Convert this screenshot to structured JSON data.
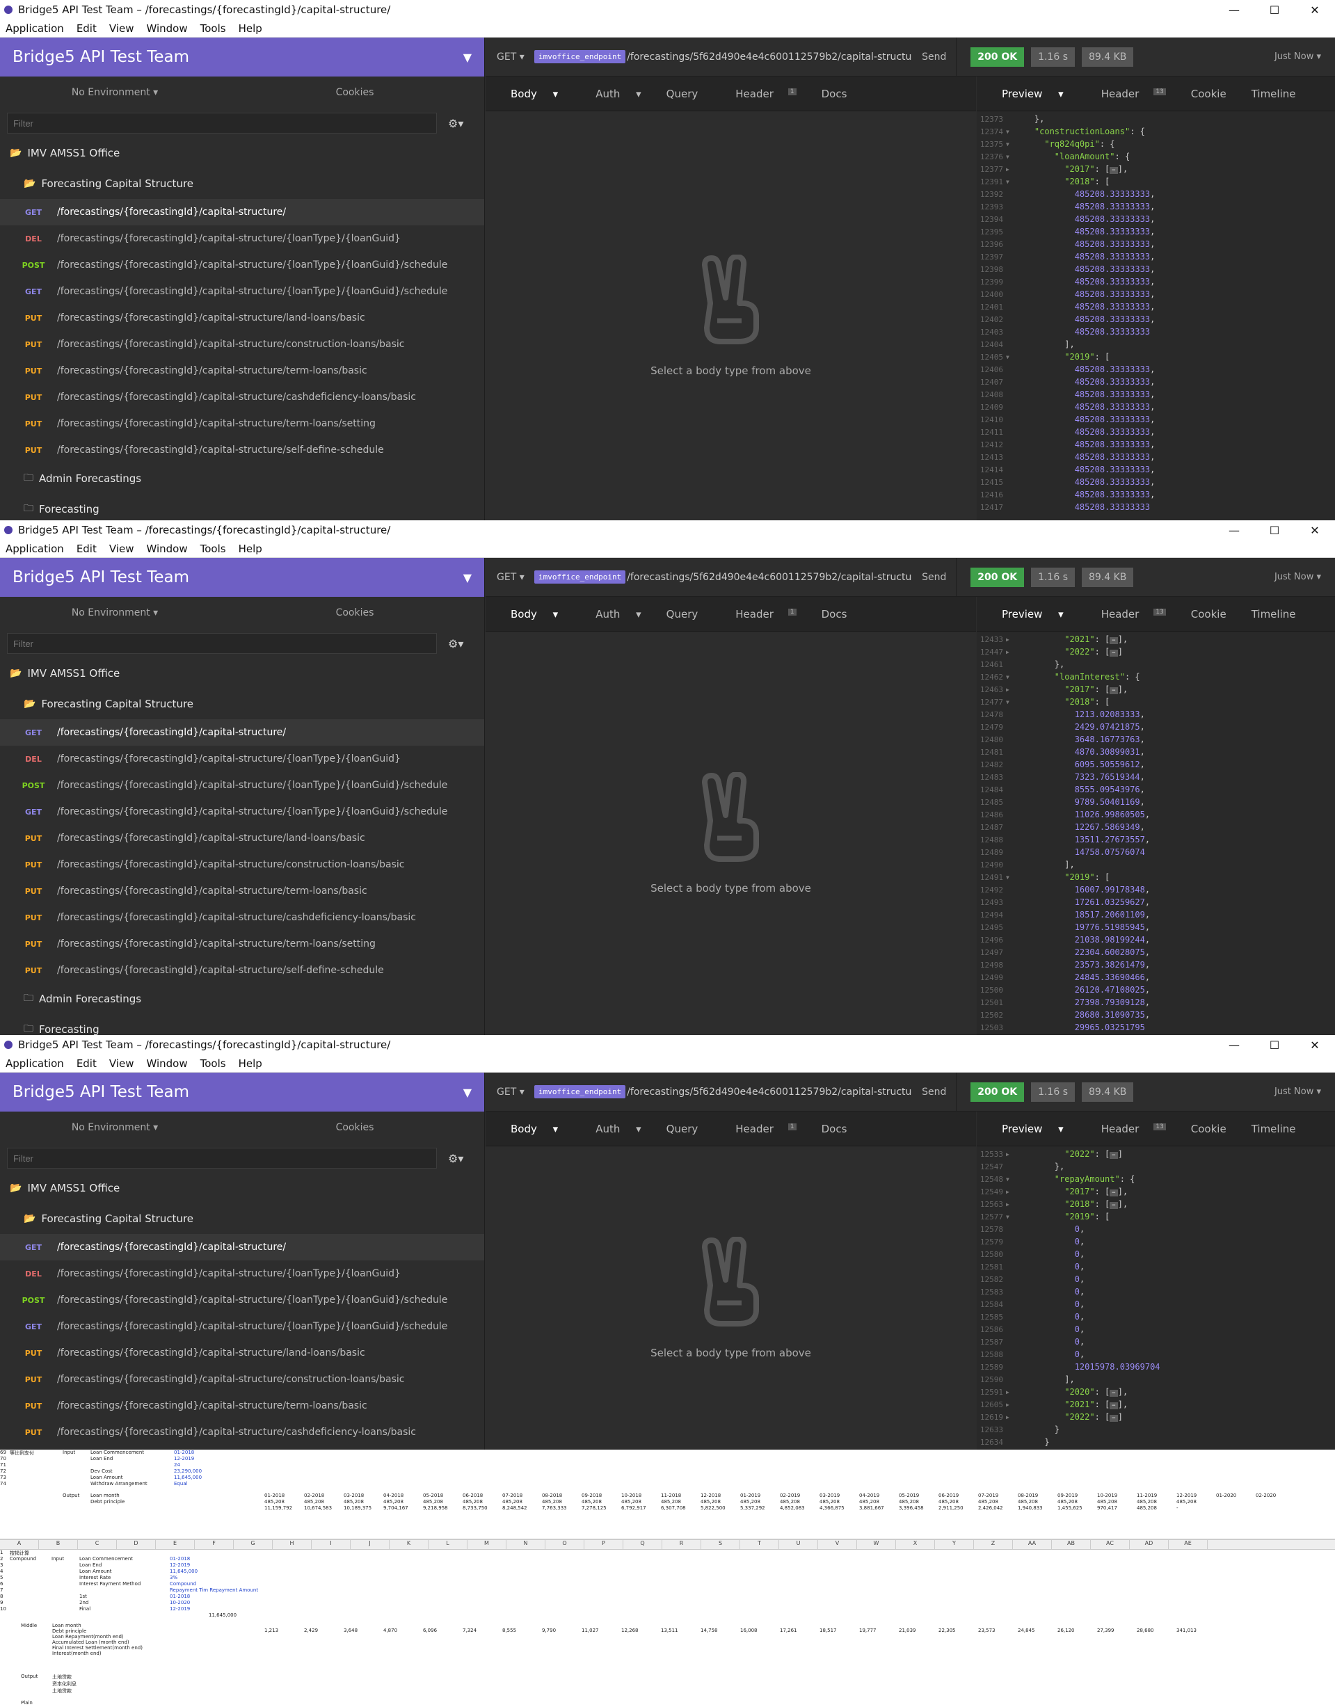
{
  "app": {
    "title": "Bridge5 API Test Team – /forecastings/{forecastingId}/capital-structure/",
    "window_controls": [
      "—",
      "☐",
      "✕"
    ],
    "menu": [
      "Application",
      "Edit",
      "View",
      "Window",
      "Tools",
      "Help"
    ]
  },
  "sidebar": {
    "team": "Bridge5 API Test Team",
    "environment": "No Environment",
    "cookies": "Cookies",
    "filter_placeholder": "Filter",
    "workspace": "IMV AMSS1 Office",
    "folder": "Forecasting Capital Structure",
    "requests": [
      {
        "method": "GET",
        "path": "/forecastings/{forecastingId}/capital-structure/"
      },
      {
        "method": "DEL",
        "path": "/forecastings/{forecastingId}/capital-structure/{loanType}/{loanGuid}"
      },
      {
        "method": "POST",
        "path": "/forecastings/{forecastingId}/capital-structure/{loanType}/{loanGuid}/schedule"
      },
      {
        "method": "GET",
        "path": "/forecastings/{forecastingId}/capital-structure/{loanType}/{loanGuid}/schedule"
      },
      {
        "method": "PUT",
        "path": "/forecastings/{forecastingId}/capital-structure/land-loans/basic"
      },
      {
        "method": "PUT",
        "path": "/forecastings/{forecastingId}/capital-structure/construction-loans/basic"
      },
      {
        "method": "PUT",
        "path": "/forecastings/{forecastingId}/capital-structure/term-loans/basic"
      },
      {
        "method": "PUT",
        "path": "/forecastings/{forecastingId}/capital-structure/cashdeficiency-loans/basic"
      },
      {
        "method": "PUT",
        "path": "/forecastings/{forecastingId}/capital-structure/term-loans/setting"
      },
      {
        "method": "PUT",
        "path": "/forecastings/{forecastingId}/capital-structure/self-define-schedule"
      }
    ],
    "other_folders": [
      "Admin Forecastings",
      "Forecasting"
    ]
  },
  "urlbar": {
    "method": "GET",
    "variable": "imvoffice_endpoint",
    "path": "/forecastings/5f62d490e4e4c600112579b2/capital-structure",
    "send": "Send",
    "status": "200 OK",
    "time": "1.16 s",
    "size": "89.4 KB",
    "when": "Just Now"
  },
  "request_tabs": [
    "Body",
    "Auth",
    "Query",
    "Header",
    "Docs"
  ],
  "request_header_count": "1",
  "response_tabs": [
    "Preview",
    "Header",
    "Cookie",
    "Timeline"
  ],
  "response_header_count": "13",
  "empty_body_hint": "Select a body type from above",
  "response1": [
    {
      "no": "12373",
      "arrow": "",
      "code": "    },"
    },
    {
      "no": "12374",
      "arrow": "▼",
      "code": "    \"constructionLoans\": {"
    },
    {
      "no": "12375",
      "arrow": "▼",
      "code": "      \"rq824q0pi\": {"
    },
    {
      "no": "12376",
      "arrow": "▼",
      "code": "        \"loanAmount\": {"
    },
    {
      "no": "12377",
      "arrow": "▶",
      "code": "          \"2017\": [⋯],"
    },
    {
      "no": "12391",
      "arrow": "▼",
      "code": "          \"2018\": ["
    },
    {
      "no": "12392",
      "arrow": "",
      "code": "            485208.33333333,"
    },
    {
      "no": "12393",
      "arrow": "",
      "code": "            485208.33333333,"
    },
    {
      "no": "12394",
      "arrow": "",
      "code": "            485208.33333333,"
    },
    {
      "no": "12395",
      "arrow": "",
      "code": "            485208.33333333,"
    },
    {
      "no": "12396",
      "arrow": "",
      "code": "            485208.33333333,"
    },
    {
      "no": "12397",
      "arrow": "",
      "code": "            485208.33333333,"
    },
    {
      "no": "12398",
      "arrow": "",
      "code": "            485208.33333333,"
    },
    {
      "no": "12399",
      "arrow": "",
      "code": "            485208.33333333,"
    },
    {
      "no": "12400",
      "arrow": "",
      "code": "            485208.33333333,"
    },
    {
      "no": "12401",
      "arrow": "",
      "code": "            485208.33333333,"
    },
    {
      "no": "12402",
      "arrow": "",
      "code": "            485208.33333333,"
    },
    {
      "no": "12403",
      "arrow": "",
      "code": "            485208.33333333"
    },
    {
      "no": "12404",
      "arrow": "",
      "code": "          ],"
    },
    {
      "no": "12405",
      "arrow": "▼",
      "code": "          \"2019\": ["
    },
    {
      "no": "12406",
      "arrow": "",
      "code": "            485208.33333333,"
    },
    {
      "no": "12407",
      "arrow": "",
      "code": "            485208.33333333,"
    },
    {
      "no": "12408",
      "arrow": "",
      "code": "            485208.33333333,"
    },
    {
      "no": "12409",
      "arrow": "",
      "code": "            485208.33333333,"
    },
    {
      "no": "12410",
      "arrow": "",
      "code": "            485208.33333333,"
    },
    {
      "no": "12411",
      "arrow": "",
      "code": "            485208.33333333,"
    },
    {
      "no": "12412",
      "arrow": "",
      "code": "            485208.33333333,"
    },
    {
      "no": "12413",
      "arrow": "",
      "code": "            485208.33333333,"
    },
    {
      "no": "12414",
      "arrow": "",
      "code": "            485208.33333333,"
    },
    {
      "no": "12415",
      "arrow": "",
      "code": "            485208.33333333,"
    },
    {
      "no": "12416",
      "arrow": "",
      "code": "            485208.33333333,"
    },
    {
      "no": "12417",
      "arrow": "",
      "code": "            485208.33333333"
    }
  ],
  "response2": [
    {
      "no": "12433",
      "arrow": "▶",
      "code": "          \"2021\": [⋯],"
    },
    {
      "no": "12447",
      "arrow": "▶",
      "code": "          \"2022\": [⋯]"
    },
    {
      "no": "12461",
      "arrow": "",
      "code": "        },"
    },
    {
      "no": "12462",
      "arrow": "▼",
      "code": "        \"loanInterest\": {"
    },
    {
      "no": "12463",
      "arrow": "▶",
      "code": "          \"2017\": [⋯],"
    },
    {
      "no": "12477",
      "arrow": "▼",
      "code": "          \"2018\": ["
    },
    {
      "no": "12478",
      "arrow": "",
      "code": "            1213.02083333,"
    },
    {
      "no": "12479",
      "arrow": "",
      "code": "            2429.07421875,"
    },
    {
      "no": "12480",
      "arrow": "",
      "code": "            3648.16773763,"
    },
    {
      "no": "12481",
      "arrow": "",
      "code": "            4870.30899031,"
    },
    {
      "no": "12482",
      "arrow": "",
      "code": "            6095.50559612,"
    },
    {
      "no": "12483",
      "arrow": "",
      "code": "            7323.76519344,"
    },
    {
      "no": "12484",
      "arrow": "",
      "code": "            8555.09543976,"
    },
    {
      "no": "12485",
      "arrow": "",
      "code": "            9789.50401169,"
    },
    {
      "no": "12486",
      "arrow": "",
      "code": "            11026.99860505,"
    },
    {
      "no": "12487",
      "arrow": "",
      "code": "            12267.5869349,"
    },
    {
      "no": "12488",
      "arrow": "",
      "code": "            13511.27673557,"
    },
    {
      "no": "12489",
      "arrow": "",
      "code": "            14758.07576074"
    },
    {
      "no": "12490",
      "arrow": "",
      "code": "          ],"
    },
    {
      "no": "12491",
      "arrow": "▼",
      "code": "          \"2019\": ["
    },
    {
      "no": "12492",
      "arrow": "",
      "code": "            16007.99178348,"
    },
    {
      "no": "12493",
      "arrow": "",
      "code": "            17261.03259627,"
    },
    {
      "no": "12494",
      "arrow": "",
      "code": "            18517.20601109,"
    },
    {
      "no": "12495",
      "arrow": "",
      "code": "            19776.51985945,"
    },
    {
      "no": "12496",
      "arrow": "",
      "code": "            21038.98199244,"
    },
    {
      "no": "12497",
      "arrow": "",
      "code": "            22304.60028075,"
    },
    {
      "no": "12498",
      "arrow": "",
      "code": "            23573.38261479,"
    },
    {
      "no": "12499",
      "arrow": "",
      "code": "            24845.33690466,"
    },
    {
      "no": "12500",
      "arrow": "",
      "code": "            26120.47108025,"
    },
    {
      "no": "12501",
      "arrow": "",
      "code": "            27398.79309128,"
    },
    {
      "no": "12502",
      "arrow": "",
      "code": "            28680.31090735,"
    },
    {
      "no": "12503",
      "arrow": "",
      "code": "            29965.03251795"
    }
  ],
  "response3": [
    {
      "no": "12533",
      "arrow": "▶",
      "code": "          \"2022\": [⋯]"
    },
    {
      "no": "12547",
      "arrow": "",
      "code": "        },"
    },
    {
      "no": "12548",
      "arrow": "▼",
      "code": "        \"repayAmount\": {"
    },
    {
      "no": "12549",
      "arrow": "▶",
      "code": "          \"2017\": [⋯],"
    },
    {
      "no": "12563",
      "arrow": "▶",
      "code": "          \"2018\": [⋯],"
    },
    {
      "no": "12577",
      "arrow": "▼",
      "code": "          \"2019\": ["
    },
    {
      "no": "12578",
      "arrow": "",
      "code": "            0,"
    },
    {
      "no": "12579",
      "arrow": "",
      "code": "            0,"
    },
    {
      "no": "12580",
      "arrow": "",
      "code": "            0,"
    },
    {
      "no": "12581",
      "arrow": "",
      "code": "            0,"
    },
    {
      "no": "12582",
      "arrow": "",
      "code": "            0,"
    },
    {
      "no": "12583",
      "arrow": "",
      "code": "            0,"
    },
    {
      "no": "12584",
      "arrow": "",
      "code": "            0,"
    },
    {
      "no": "12585",
      "arrow": "",
      "code": "            0,"
    },
    {
      "no": "12586",
      "arrow": "",
      "code": "            0,"
    },
    {
      "no": "12587",
      "arrow": "",
      "code": "            0,"
    },
    {
      "no": "12588",
      "arrow": "",
      "code": "            0,"
    },
    {
      "no": "12589",
      "arrow": "",
      "code": "            12015978.03969704"
    },
    {
      "no": "12590",
      "arrow": "",
      "code": "          ],"
    },
    {
      "no": "12591",
      "arrow": "▶",
      "code": "          \"2020\": [⋯],"
    },
    {
      "no": "12605",
      "arrow": "▶",
      "code": "          \"2021\": [⋯],"
    },
    {
      "no": "12619",
      "arrow": "▶",
      "code": "          \"2022\": [⋯]"
    },
    {
      "no": "12633",
      "arrow": "",
      "code": "        }"
    },
    {
      "no": "12634",
      "arrow": "",
      "code": "      }"
    }
  ],
  "sheet_top": {
    "rows": [
      {
        "rn": "69",
        "a": "等比例支付",
        "b": "Input",
        "c": "Loan Commencement",
        "d": "01-2018"
      },
      {
        "rn": "70",
        "a": "",
        "b": "",
        "c": "Loan End",
        "d": "12-2019"
      },
      {
        "rn": "71",
        "a": "",
        "b": "",
        "c": "",
        "d": "24"
      },
      {
        "rn": "72",
        "a": "",
        "b": "",
        "c": "Dev Cost",
        "d": "23,290,000"
      },
      {
        "rn": "73",
        "a": "",
        "b": "",
        "c": "Loan Amount",
        "d": "11,645,000"
      },
      {
        "rn": "74",
        "a": "",
        "b": "",
        "c": "Withdraw Arrangement",
        "d": "Equal"
      }
    ],
    "output_label": "Output",
    "loan_month_label": "Loan month",
    "debt_principle_label": "Debt principle",
    "months": [
      "01-2018",
      "02-2018",
      "03-2018",
      "04-2018",
      "05-2018",
      "06-2018",
      "07-2018",
      "08-2018",
      "09-2018",
      "10-2018",
      "11-2018",
      "12-2018",
      "01-2019",
      "02-2019",
      "03-2019",
      "04-2019",
      "05-2019",
      "06-2019",
      "07-2019",
      "08-2019",
      "09-2019",
      "10-2019",
      "11-2019",
      "12-2019",
      "01-2020",
      "02-2020"
    ],
    "principle": "485,208",
    "cumulative": [
      "11,159,792",
      "10,674,583",
      "10,189,375",
      "9,704,167",
      "9,218,958",
      "8,733,750",
      "8,248,542",
      "7,763,333",
      "7,278,125",
      "6,792,917",
      "6,307,708",
      "5,822,500",
      "5,337,292",
      "4,852,083",
      "4,366,875",
      "3,881,667",
      "3,396,458",
      "2,911,250",
      "2,426,042",
      "1,940,833",
      "1,455,625",
      "970,417",
      "485,208",
      "-"
    ]
  },
  "sheet_bottom": {
    "columns": [
      "A",
      "B",
      "C",
      "D",
      "E",
      "F",
      "G",
      "H",
      "I",
      "J",
      "K",
      "L",
      "M",
      "N",
      "O",
      "P",
      "Q",
      "R",
      "S",
      "T",
      "U",
      "V",
      "W",
      "X",
      "Y",
      "Z",
      "AA",
      "AB",
      "AC",
      "AD",
      "AE"
    ],
    "rows": [
      {
        "rn": "1",
        "a": "按揭计算",
        "b": "",
        "c": "",
        "d": ""
      },
      {
        "rn": "2",
        "a": "Compound",
        "b": "Input",
        "c": "Loan Commencement",
        "d": "01-2018"
      },
      {
        "rn": "3",
        "a": "",
        "b": "",
        "c": "Loan End",
        "d": "12-2019"
      },
      {
        "rn": "4",
        "a": "",
        "b": "",
        "c": "Loan Amount",
        "d": "11,645,000"
      },
      {
        "rn": "5",
        "a": "",
        "b": "",
        "c": "Interest Rate",
        "d": "3%"
      },
      {
        "rn": "6",
        "a": "",
        "b": "",
        "c": "Interest Payment Method",
        "d": "Compound"
      },
      {
        "rn": "7",
        "a": "",
        "b": "",
        "c": "",
        "d": "Repayment Tim Repayment Amount"
      },
      {
        "rn": "8",
        "a": "",
        "b": "",
        "c": "1st",
        "d": "01-2018"
      },
      {
        "rn": "9",
        "a": "",
        "b": "",
        "c": "2nd",
        "d": "10-2020"
      },
      {
        "rn": "10",
        "a": "",
        "b": "",
        "c": "Final",
        "d": "12-2019"
      }
    ],
    "final_amount": "11,645,000",
    "middle_label": "Middle",
    "middle_rows": [
      "Loan month",
      "Debt principle",
      "Loan Repayment(month end)",
      "Accumulated Loan (month end)",
      "Final Interest Settlement(month end)",
      "Interest(month end)"
    ],
    "interest": [
      "1,213",
      "2,429",
      "3,648",
      "4,870",
      "6,096",
      "7,324",
      "8,555",
      "9,790",
      "11,027",
      "12,268",
      "13,511",
      "14,758",
      "16,008",
      "17,261",
      "18,517",
      "19,777",
      "21,039",
      "22,305",
      "23,573",
      "24,845",
      "26,120",
      "27,399",
      "28,680",
      "341,013"
    ],
    "output_label": "Output",
    "output_rows": [
      "土地贷款",
      "资本化利息",
      "土地贷款"
    ],
    "row_last": "Plain"
  }
}
